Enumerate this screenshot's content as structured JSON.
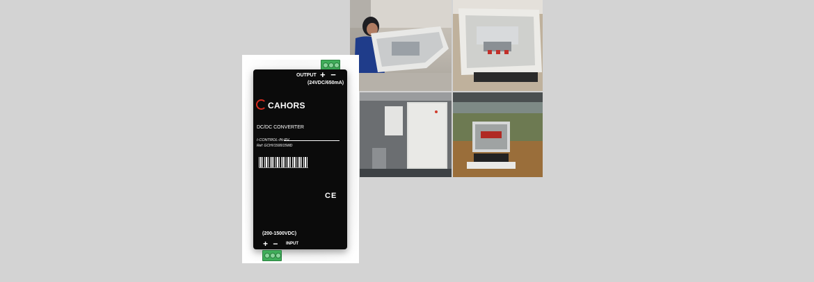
{
  "product": {
    "output_label": "OUTPUT",
    "output_polarity": "+ −",
    "output_spec": "(24VDC/650mA)",
    "brand": "CAHORS",
    "type": "DC/DC CONVERTER",
    "name": "I-CONTROL-IN-PV",
    "ref": "Ref: GCHV1500/15WD",
    "ce_mark": "CE",
    "input_spec": "(200-1500VDC)",
    "input_polarity": "+ −",
    "input_label": "INPUT"
  },
  "colors": {
    "background": "#d3d3d3",
    "module": "#0b0b0b",
    "terminal": "#3fae5a",
    "brand_accent": "#d62a1e"
  },
  "photos": [
    "photo-worker-assembling-enclosure",
    "photo-open-combiner-box",
    "photo-wall-mounted-cabinets",
    "photo-field-installed-box"
  ]
}
